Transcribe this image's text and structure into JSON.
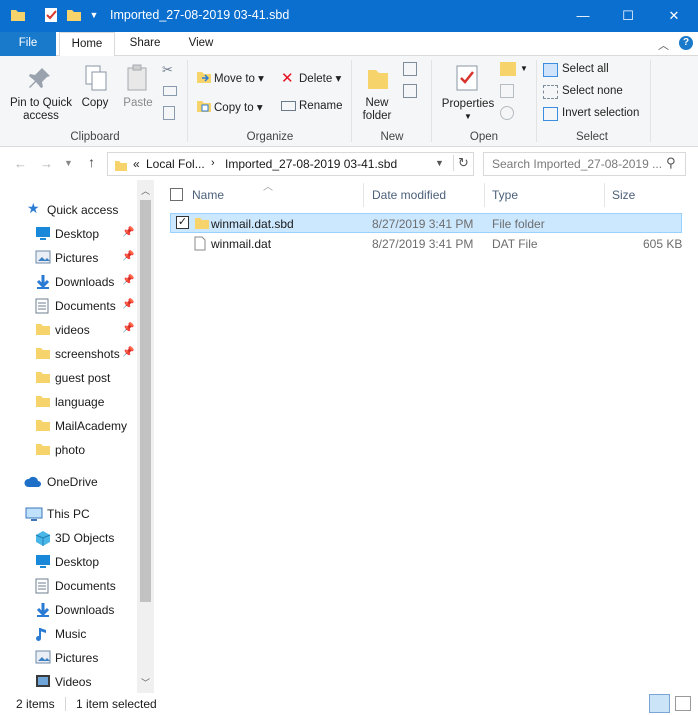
{
  "window": {
    "title": "Imported_27-08-2019 03-41.sbd",
    "controls": {
      "minimize": "—",
      "maximize": "☐",
      "close": "✕"
    }
  },
  "ribbon_tabs": [
    "File",
    "Home",
    "Share",
    "View"
  ],
  "ribbon": {
    "clipboard": {
      "pin_label_1": "Pin to Quick",
      "pin_label_2": "access",
      "copy": "Copy",
      "paste": "Paste",
      "group": "Clipboard"
    },
    "organize": {
      "move_to": "Move to",
      "copy_to": "Copy to",
      "delete": "Delete",
      "rename": "Rename",
      "group": "Organize"
    },
    "new": {
      "new_folder_1": "New",
      "new_folder_2": "folder",
      "group": "New"
    },
    "open": {
      "properties": "Properties",
      "group": "Open"
    },
    "select": {
      "select_all": "Select all",
      "select_none": "Select none",
      "invert_selection": "Invert selection",
      "group": "Select"
    }
  },
  "address": {
    "overflow": "«",
    "crumbs": [
      "Local Fol...",
      "Imported_27-08-2019 03-41.sbd"
    ],
    "search_placeholder": "Search Imported_27-08-2019 ..."
  },
  "nav": {
    "quick_access": "Quick access",
    "quick_items": [
      {
        "label": "Desktop",
        "icon": "desktop-icon",
        "pinned": true
      },
      {
        "label": "Pictures",
        "icon": "pictures-icon",
        "pinned": true
      },
      {
        "label": "Downloads",
        "icon": "downloads-icon",
        "pinned": true
      },
      {
        "label": "Documents",
        "icon": "documents-icon",
        "pinned": true
      },
      {
        "label": "videos",
        "icon": "folder-icon",
        "pinned": true
      },
      {
        "label": "screenshots",
        "icon": "folder-icon",
        "pinned": true
      },
      {
        "label": "guest post",
        "icon": "folder-icon",
        "pinned": false
      },
      {
        "label": "language",
        "icon": "folder-icon",
        "pinned": false
      },
      {
        "label": "MailAcademy",
        "icon": "folder-icon",
        "pinned": false
      },
      {
        "label": "photo",
        "icon": "folder-icon",
        "pinned": false
      }
    ],
    "onedrive": "OneDrive",
    "this_pc": "This PC",
    "pc_items": [
      {
        "label": "3D Objects",
        "icon": "3d-objects-icon"
      },
      {
        "label": "Desktop",
        "icon": "desktop-icon"
      },
      {
        "label": "Documents",
        "icon": "documents-icon"
      },
      {
        "label": "Downloads",
        "icon": "downloads-icon"
      },
      {
        "label": "Music",
        "icon": "music-icon"
      },
      {
        "label": "Pictures",
        "icon": "pictures-icon"
      },
      {
        "label": "Videos",
        "icon": "videos-icon"
      }
    ]
  },
  "columns": [
    "Name",
    "Date modified",
    "Type",
    "Size"
  ],
  "files": [
    {
      "name": "winmail.dat.sbd",
      "date": "8/27/2019 3:41 PM",
      "type": "File folder",
      "size": "",
      "selected": true,
      "icon": "folder-icon"
    },
    {
      "name": "winmail.dat",
      "date": "8/27/2019 3:41 PM",
      "type": "DAT File",
      "size": "605 KB",
      "selected": false,
      "icon": "file-icon"
    }
  ],
  "status": {
    "items": "2 items",
    "selected": "1 item selected"
  },
  "colors": {
    "titlebar": "#0b6fd0",
    "selection": "#cce8ff",
    "selection_border": "#99d1ff",
    "delete_red": "#e81123"
  }
}
